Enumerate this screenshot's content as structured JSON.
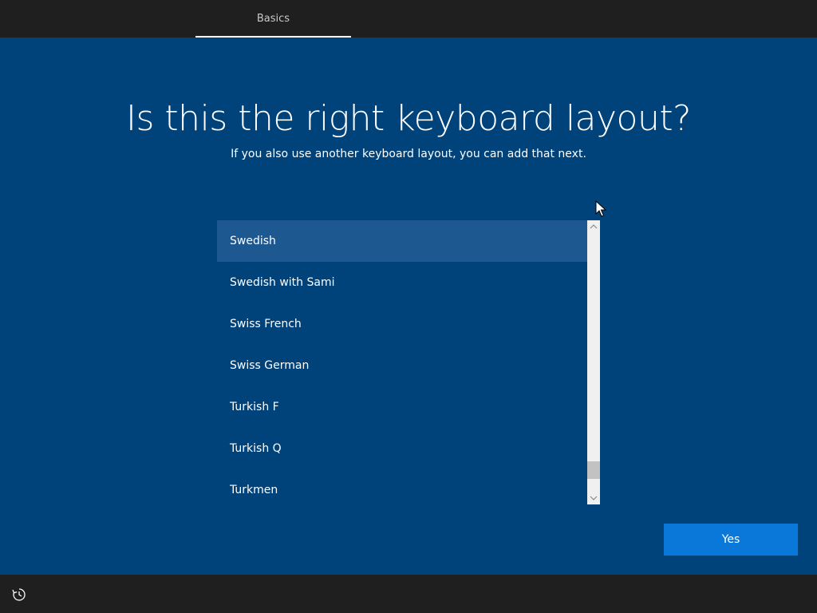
{
  "header": {
    "tab_label": "Basics"
  },
  "main": {
    "title": "Is this the right keyboard layout?",
    "subtitle": "If you also use another keyboard layout, you can add that next.",
    "layouts": [
      {
        "label": "Swedish",
        "selected": true
      },
      {
        "label": "Swedish with Sami",
        "selected": false
      },
      {
        "label": "Swiss French",
        "selected": false
      },
      {
        "label": "Swiss German",
        "selected": false
      },
      {
        "label": "Turkish F",
        "selected": false
      },
      {
        "label": "Turkish Q",
        "selected": false
      },
      {
        "label": "Turkmen",
        "selected": false
      }
    ],
    "yes_label": "Yes"
  },
  "footer": {
    "accessibility_icon": "accessibility-icon"
  },
  "colors": {
    "background": "#00427a",
    "bar": "#1f1f1f",
    "selected_item": "#1e5890",
    "accent_button": "#0a78d8"
  }
}
